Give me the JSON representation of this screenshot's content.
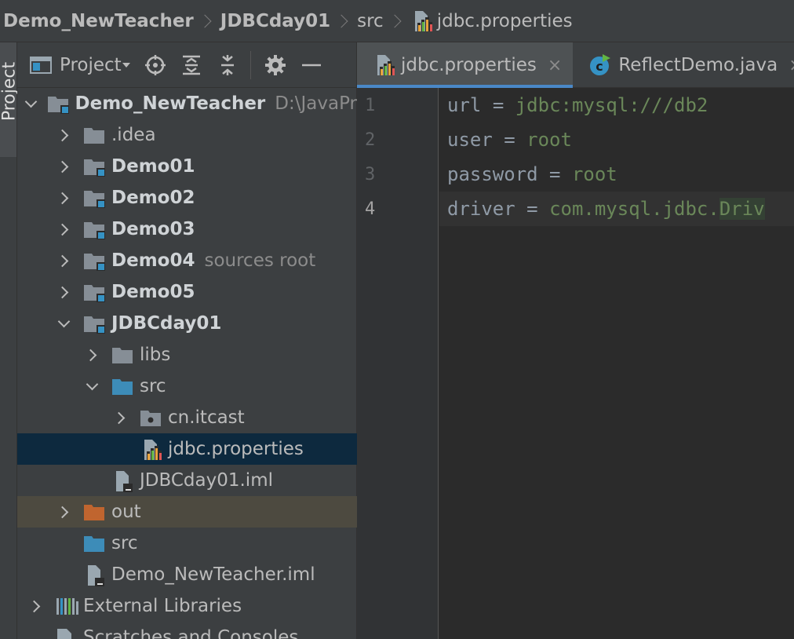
{
  "breadcrumb": {
    "items": [
      "Demo_NewTeacher",
      "JDBCday01",
      "src",
      "jdbc.properties"
    ]
  },
  "stripe": {
    "label": "Project"
  },
  "project_toolbar": {
    "title": "Project"
  },
  "tree": [
    {
      "label": "Demo_NewTeacher",
      "hint": "D:\\JavaPr",
      "level": 0,
      "chevron": "down",
      "icon": "module-folder",
      "bold": true
    },
    {
      "label": ".idea",
      "level": 1,
      "chevron": "right",
      "icon": "folder",
      "bold": false
    },
    {
      "label": "Demo01",
      "level": 1,
      "chevron": "right",
      "icon": "module-folder",
      "bold": true
    },
    {
      "label": "Demo02",
      "level": 1,
      "chevron": "right",
      "icon": "module-folder",
      "bold": true
    },
    {
      "label": "Demo03",
      "level": 1,
      "chevron": "right",
      "icon": "module-folder",
      "bold": true
    },
    {
      "label": "Demo04",
      "hint": "sources root",
      "level": 1,
      "chevron": "right",
      "icon": "module-folder",
      "bold": true
    },
    {
      "label": "Demo05",
      "level": 1,
      "chevron": "right",
      "icon": "module-folder",
      "bold": true
    },
    {
      "label": "JDBCday01",
      "level": 1,
      "chevron": "down",
      "icon": "module-folder",
      "bold": true
    },
    {
      "label": "libs",
      "level": 2,
      "chevron": "right",
      "icon": "folder",
      "bold": false
    },
    {
      "label": "src",
      "level": 2,
      "chevron": "down",
      "icon": "source-folder",
      "bold": false
    },
    {
      "label": "cn.itcast",
      "level": 3,
      "chevron": "right",
      "icon": "package",
      "bold": false
    },
    {
      "label": "jdbc.properties",
      "level": 3,
      "chevron": "none",
      "icon": "properties-file",
      "bold": false,
      "selected": true
    },
    {
      "label": "JDBCday01.iml",
      "level": 2,
      "chevron": "none",
      "icon": "iml-file",
      "bold": false
    },
    {
      "label": "out",
      "level": 1,
      "chevron": "right",
      "icon": "excluded-folder",
      "bold": false,
      "excluded": true
    },
    {
      "label": "src",
      "level": 1,
      "chevron": "none",
      "icon": "source-folder",
      "bold": false
    },
    {
      "label": "Demo_NewTeacher.iml",
      "level": 1,
      "chevron": "none",
      "icon": "iml-file",
      "bold": false
    },
    {
      "label": "External Libraries",
      "level": 0,
      "chevron": "right",
      "icon": "libraries",
      "bold": false
    },
    {
      "label": "Scratches and Consoles",
      "level": 0,
      "chevron": "none",
      "icon": "scratches",
      "bold": false
    }
  ],
  "tabs": [
    {
      "label": "jdbc.properties",
      "icon": "properties-file",
      "active": true,
      "close": "×"
    },
    {
      "label": "ReflectDemo.java",
      "icon": "java-class",
      "active": false,
      "close": "×"
    }
  ],
  "editor": {
    "lines": [
      {
        "num": "1",
        "key": "url",
        "eq": "=",
        "value": "jdbc:mysql:///db2"
      },
      {
        "num": "2",
        "key": "user",
        "eq": "=",
        "value": "root"
      },
      {
        "num": "3",
        "key": "password",
        "eq": "=",
        "value": "root"
      },
      {
        "num": "4",
        "key": "driver",
        "eq": "=",
        "value": "com.mysql.jdbc.",
        "value_hl": "Driv",
        "current": true
      }
    ]
  },
  "colors": {
    "folder": "#868e96",
    "module_badge": "#3592c4",
    "source_folder": "#3d8cb8",
    "excluded_folder": "#c0652f",
    "selection": "#0d293e",
    "string_value": "#6a8759",
    "tab_underline": "#4a88c7"
  }
}
